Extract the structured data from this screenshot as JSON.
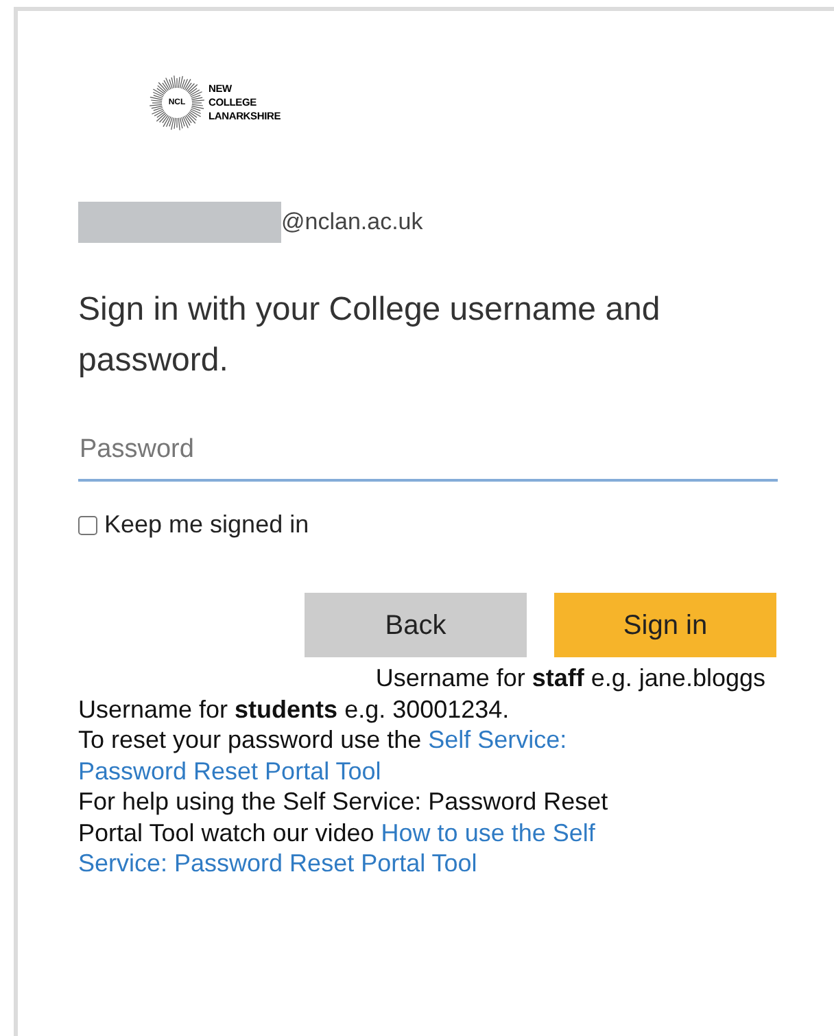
{
  "logo": {
    "badge": "NCL",
    "lines": [
      "NEW",
      "COLLEGE",
      "LANARKSHIRE"
    ]
  },
  "account": {
    "domain": "@nclan.ac.uk"
  },
  "heading": "Sign in with your College username and password.",
  "password": {
    "placeholder": "Password"
  },
  "keep_signed_in": {
    "label": "Keep me signed in",
    "checked": false
  },
  "buttons": [
    {
      "label": "Back",
      "kind": "secondary"
    },
    {
      "label": "Sign in",
      "kind": "primary"
    }
  ],
  "staff_hint": "Username for **staff** e.g. jane.bloggs",
  "help_lines": [
    {
      "segments": [
        {
          "kind": "text",
          "text": "Username for **students** e.g. 30001234."
        }
      ]
    },
    {
      "segments": [
        {
          "kind": "text",
          "text": "To reset your password use the "
        },
        {
          "kind": "link",
          "text": "Self Service:"
        }
      ]
    },
    {
      "segments": [
        {
          "kind": "link",
          "text": "Password Reset Portal Tool"
        }
      ]
    },
    {
      "segments": [
        {
          "kind": "text",
          "text": "For help using the Self Service: Password Reset"
        }
      ]
    },
    {
      "segments": [
        {
          "kind": "text",
          "text": "Portal Tool watch our video "
        },
        {
          "kind": "link",
          "text": "How to use the Self"
        }
      ]
    },
    {
      "segments": [
        {
          "kind": "link",
          "text": "Service: Password Reset Portal Tool"
        }
      ]
    }
  ]
}
